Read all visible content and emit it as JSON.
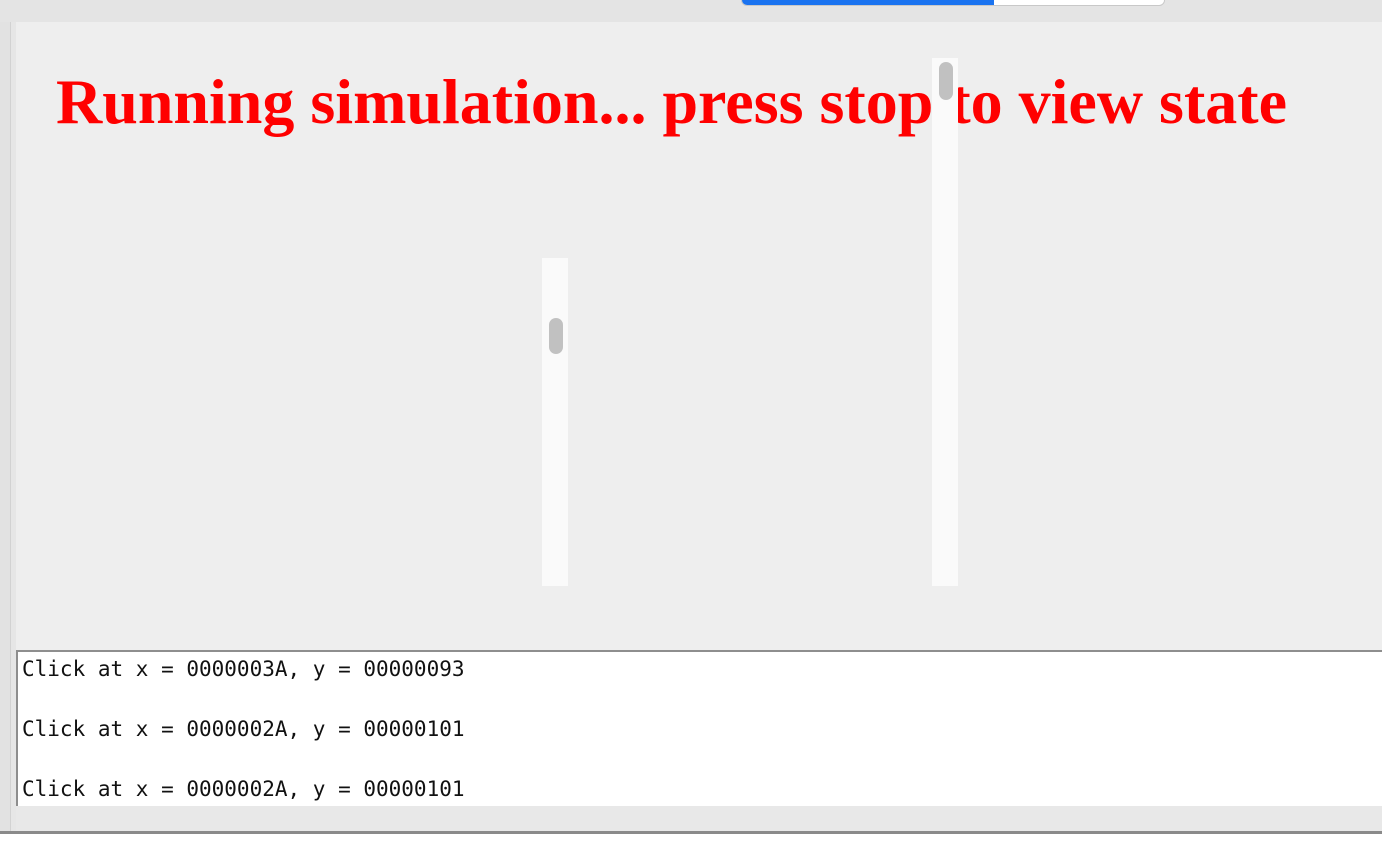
{
  "stage": {
    "message": "Running simulation... press stop to view state",
    "message_color": "#ff0000"
  },
  "segmented_control": {
    "selected_color": "#1a73f0"
  },
  "scrollbars": [
    {
      "name": "scrollbar-left",
      "position_fraction": 0.1
    },
    {
      "name": "scrollbar-right",
      "position_fraction": 0.0
    }
  ],
  "log": {
    "lines": [
      "Click at x = 0000003A, y = 00000093",
      "Click at x = 0000002A, y = 00000101",
      "Click at x = 0000002A, y = 00000101"
    ]
  }
}
